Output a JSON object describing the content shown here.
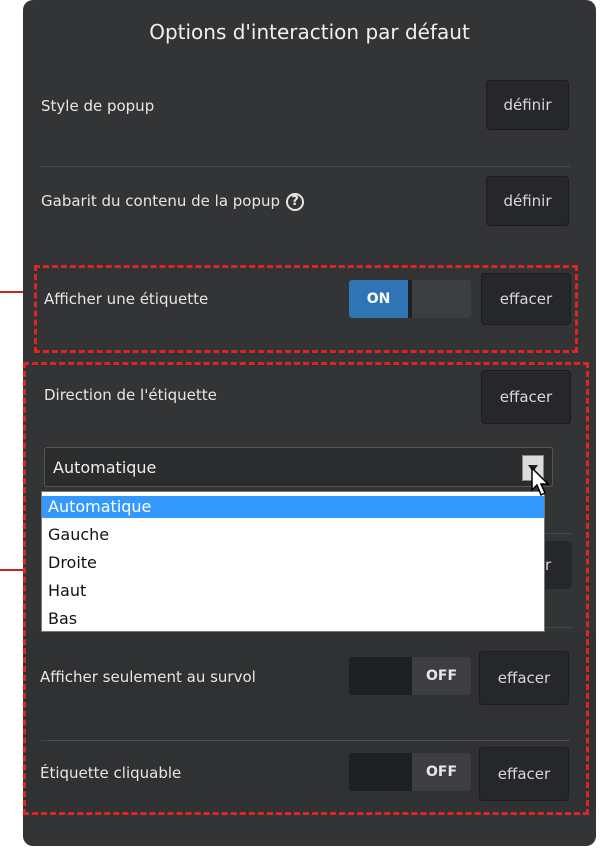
{
  "panel": {
    "title": "Options d'interaction par défaut"
  },
  "rows": {
    "popup_style": {
      "label": "Style de popup",
      "button": "définir"
    },
    "popup_template": {
      "label": "Gabarit du contenu de la popup",
      "help": "?",
      "button": "définir"
    },
    "show_label": {
      "label": "Afficher une étiquette",
      "toggle_on": "ON",
      "button": "effacer",
      "state": "on"
    },
    "label_direction": {
      "label": "Direction de l'étiquette",
      "button": "effacer"
    },
    "hover_only": {
      "label": "Afficher seulement au survol",
      "toggle_off": "OFF",
      "button": "effacer",
      "state": "off"
    },
    "clickable_label": {
      "label": "Étiquette cliquable",
      "toggle_off": "OFF",
      "button": "effacer",
      "state": "off"
    }
  },
  "direction_select": {
    "selected": "Automatique",
    "options": [
      "Automatique",
      "Gauche",
      "Droite",
      "Haut",
      "Bas"
    ]
  },
  "hidden_row_partial_button": "r",
  "colors": {
    "panel_bg": "#333436",
    "toggle_on": "#2f74b5",
    "highlight_dash": "#e02424",
    "dropdown_selected": "#3399ff"
  }
}
